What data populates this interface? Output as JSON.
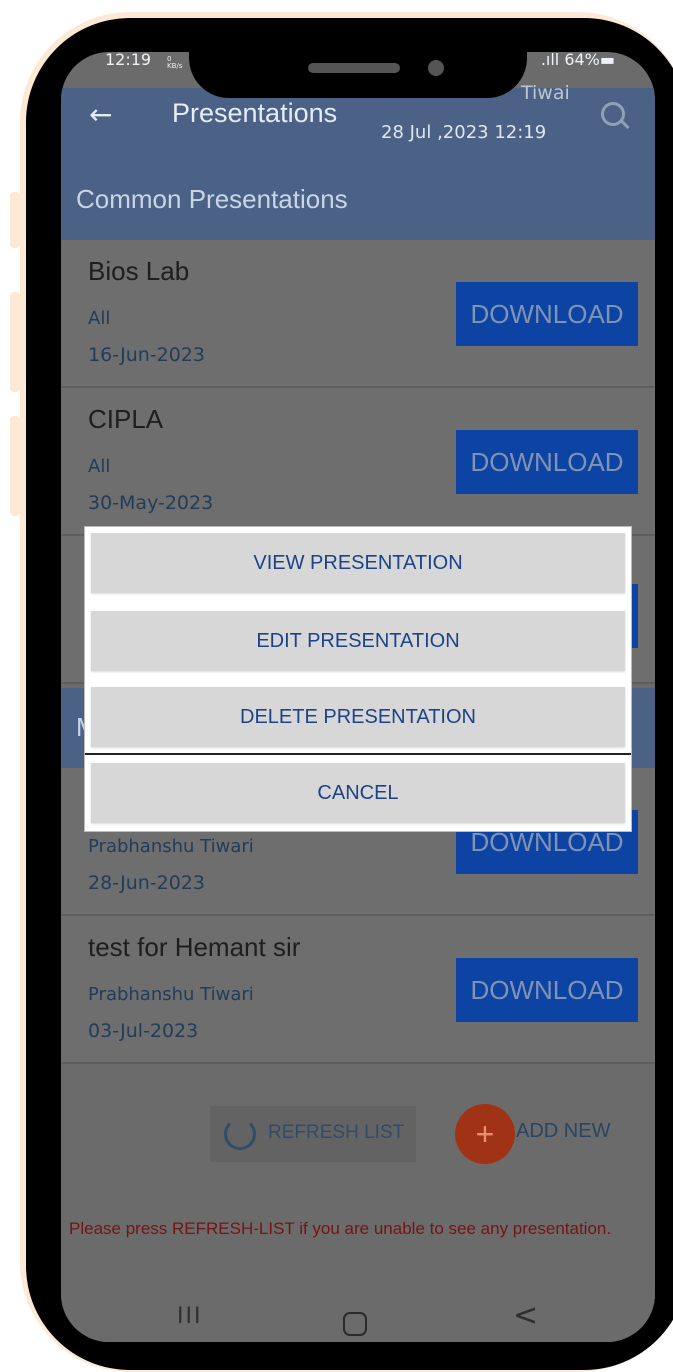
{
  "status_bar": {
    "time": "12:19",
    "kb": "0\nKB/s",
    "signal_battery": ".ıll 64%▬"
  },
  "header": {
    "back_icon": "←",
    "title": "Presentations",
    "user_partial": "Tiwai",
    "datetime": "28 Jul ,2023 12:19"
  },
  "sections": {
    "common": "Common Presentations",
    "mine_partial": "M"
  },
  "cards": [
    {
      "title": "Bios Lab",
      "subtitle": "All",
      "date": "16-Jun-2023",
      "button": "DOWNLOAD"
    },
    {
      "title": "CIPLA",
      "subtitle": "All",
      "date": "30-May-2023",
      "button": "DOWNLOAD"
    },
    {
      "title": "",
      "subtitle": "Prabhanshu Tiwari",
      "date": "28-Jun-2023",
      "button": "DOWNLOAD"
    },
    {
      "title": "test for Hemant sir",
      "subtitle": "Prabhanshu Tiwari",
      "date": "03-Jul-2023",
      "button": "DOWNLOAD"
    }
  ],
  "footer": {
    "refresh_label": "REFRESH LIST",
    "add_icon": "+",
    "add_label": "ADD NEW",
    "warning": "Please press REFRESH-LIST if you are unable to see any presentation."
  },
  "dialog": {
    "view": "VIEW PRESENTATION",
    "edit": "EDIT PRESENTATION",
    "delete": "DELETE PRESENTATION",
    "cancel": "CANCEL"
  },
  "navbar": {
    "recents": "III",
    "back": "<"
  }
}
